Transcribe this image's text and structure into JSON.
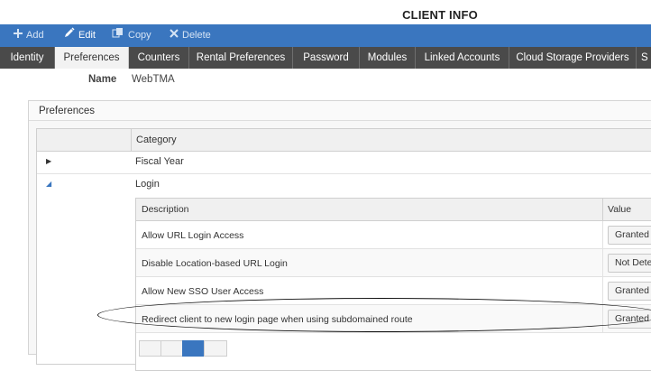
{
  "page": {
    "title": "CLIENT INFO"
  },
  "toolbar": {
    "add": "Add",
    "edit": "Edit",
    "copy": "Copy",
    "delete": "Delete"
  },
  "tabs": [
    "Identity",
    "Preferences",
    "Counters",
    "Rental Preferences",
    "Password",
    "Modules",
    "Linked Accounts",
    "Cloud Storage Providers",
    "S"
  ],
  "active_tab": "Preferences",
  "name": {
    "label": "Name",
    "value": "WebTMA"
  },
  "panel": {
    "title": "Preferences"
  },
  "grid": {
    "header": "Category",
    "rows": [
      {
        "label": "Fiscal Year",
        "expanded": false
      },
      {
        "label": "Login",
        "expanded": true
      }
    ]
  },
  "subgrid": {
    "col_description": "Description",
    "col_value": "Value",
    "rows": [
      {
        "description": "Allow URL Login Access",
        "value": "Granted"
      },
      {
        "description": "Disable Location-based URL Login",
        "value": "Not Dete"
      },
      {
        "description": "Allow New SSO User Access",
        "value": "Granted"
      },
      {
        "description": "Redirect client to new login page when using subdomained route",
        "value": "Granted"
      }
    ]
  }
}
